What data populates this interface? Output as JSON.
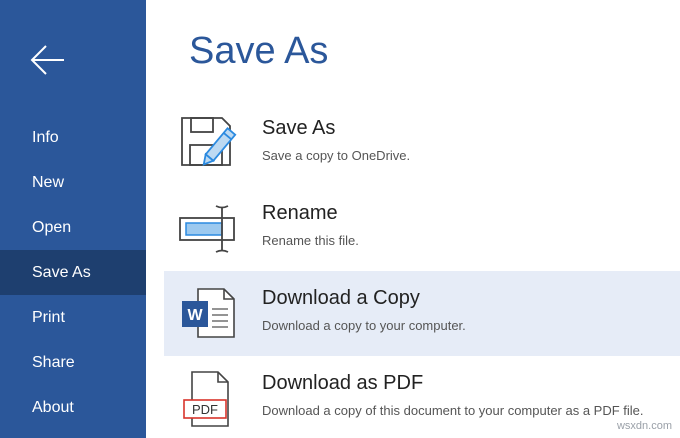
{
  "sidebar": {
    "back_icon": "arrow-left-icon",
    "items": [
      {
        "label": "Info"
      },
      {
        "label": "New"
      },
      {
        "label": "Open"
      },
      {
        "label": "Save As",
        "active": true
      },
      {
        "label": "Print"
      },
      {
        "label": "Share"
      },
      {
        "label": "About"
      }
    ]
  },
  "main": {
    "title": "Save As",
    "options": [
      {
        "title": "Save As",
        "description": "Save a copy to OneDrive.",
        "icon": "floppy-pencil-icon"
      },
      {
        "title": "Rename",
        "description": "Rename this file.",
        "icon": "rename-icon"
      },
      {
        "title": "Download a Copy",
        "description": "Download a copy to your computer.",
        "icon": "word-document-icon",
        "selected": true
      },
      {
        "title": "Download as PDF",
        "description": "Download a copy of this document to your computer as a PDF file.",
        "icon": "pdf-document-icon",
        "pdf_label": "PDF"
      }
    ]
  },
  "watermark": "wsxdn.com",
  "colors": {
    "sidebar": "#2b579a",
    "sidebar_active": "#1e3f6f",
    "title": "#2b579a",
    "selected_row": "#e6ecf7",
    "icon_accent": "#2b8ae0",
    "pdf_red": "#d9342b"
  }
}
